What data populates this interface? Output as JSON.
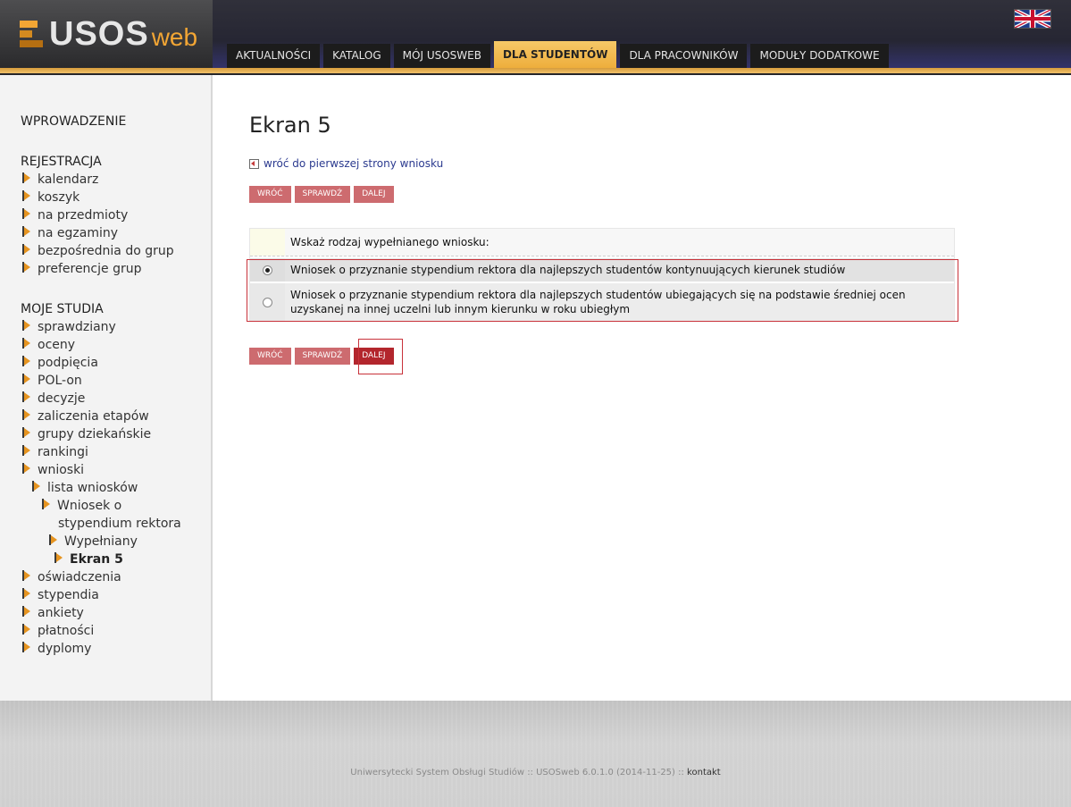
{
  "header": {
    "logo_main": "USOS",
    "logo_sub": "web",
    "tabs": [
      {
        "label": "AKTUALNOŚCI"
      },
      {
        "label": "KATALOG"
      },
      {
        "label": "MÓJ USOSWEB"
      },
      {
        "label": "DLA STUDENTÓW"
      },
      {
        "label": "DLA PRACOWNIKÓW"
      },
      {
        "label": "MODUŁY DODATKOWE"
      }
    ],
    "active_tab": "DLA STUDENTÓW",
    "flag_icon": "uk-flag-icon"
  },
  "sidebar": {
    "wprowadzenie": "WPROWADZENIE",
    "rejestracja": {
      "title": "REJESTRACJA",
      "items": [
        "kalendarz",
        "koszyk",
        "na przedmioty",
        "na egzaminy",
        "bezpośrednia do grup",
        "preferencje grup"
      ]
    },
    "moje_studia": {
      "title": "MOJE STUDIA",
      "items": [
        "sprawdziany",
        "oceny",
        "podpięcia",
        "POL-on",
        "decyzje",
        "zaliczenia etapów",
        "grupy dziekańskie",
        "rankingi",
        "wnioski"
      ],
      "wnioski_sub": {
        "lista": "lista wniosków",
        "wniosek_line1": "Wniosek o",
        "wniosek_line2": "stypendium rektora",
        "wypelniany": "Wypełniany",
        "ekran": "Ekran 5"
      },
      "items_after": [
        "oświadczenia",
        "stypendia",
        "ankiety",
        "płatności",
        "dyplomy"
      ]
    }
  },
  "main": {
    "title": "Ekran 5",
    "back_link": "wróć do pierwszej strony wniosku",
    "buttons": {
      "back": "WRÓĆ",
      "check": "SPRAWDŹ",
      "next": "DALEJ"
    },
    "question": "Wskaż rodzaj wypełnianego wniosku:",
    "options": [
      {
        "label": "Wniosek o przyznanie stypendium rektora dla najlepszych studentów kontynuujących kierunek studiów",
        "checked": true
      },
      {
        "label": "Wniosek o przyznanie stypendium rektora dla najlepszych studentów ubiegających się na podstawie średniej ocen uzyskanej na innej uczelni lub innym kierunku w roku ubiegłym",
        "checked": false
      }
    ]
  },
  "footer": {
    "text": "Uniwersytecki System Obsługi Studiów :: USOSweb 6.0.1.0 (2014-11-25) :: ",
    "contact": "kontakt"
  },
  "colors": {
    "accent_orange": "#f3a634",
    "button_red": "#cd6b6f",
    "button_red_active": "#b3262d",
    "highlight_red": "#c8323a"
  }
}
